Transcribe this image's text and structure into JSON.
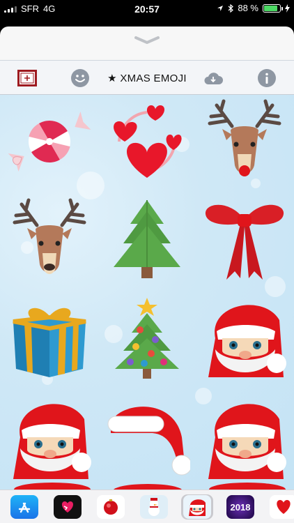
{
  "status_bar": {
    "carrier": "SFR",
    "network": "4G",
    "time": "20:57",
    "battery_percent_label": "88 %",
    "battery_level": 0.88
  },
  "toolbar": {
    "title": "★ XMAS EMOJI"
  },
  "stickers": [
    {
      "name": "candy"
    },
    {
      "name": "hearts"
    },
    {
      "name": "reindeer-red-nose"
    },
    {
      "name": "reindeer"
    },
    {
      "name": "fir-tree"
    },
    {
      "name": "red-bow"
    },
    {
      "name": "gift-box"
    },
    {
      "name": "christmas-tree"
    },
    {
      "name": "santa-face"
    },
    {
      "name": "santa-face"
    },
    {
      "name": "santa-hat"
    },
    {
      "name": "santa-face"
    }
  ],
  "tray": {
    "apps": [
      "app-store",
      "digital-touch",
      "red-ornament",
      "snowman",
      "xmas-emoji",
      "2018",
      "heart"
    ],
    "year_label": "2018",
    "selected": "xmas-emoji"
  },
  "colors": {
    "accent_red": "#e0151b",
    "background_blue": "#c4e3f5",
    "battery_green": "#4cd964"
  }
}
